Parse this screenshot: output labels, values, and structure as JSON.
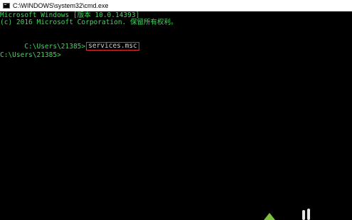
{
  "window": {
    "title": "C:\\WINDOWS\\system32\\cmd.exe"
  },
  "console": {
    "header_line_1": "Microsoft Windows [版本 10.0.14393]",
    "header_line_2": "(c) 2016 Microsoft Corporation. 保留所有权利。",
    "prompt_1": "C:\\Users\\21385>",
    "command_1": "services.msc",
    "prompt_2": "C:\\Users\\21385>"
  },
  "colors": {
    "background": "#000000",
    "header_text": "#41d85b",
    "prompt_text": "#c8c8c8",
    "highlight_box": "#e23030"
  }
}
